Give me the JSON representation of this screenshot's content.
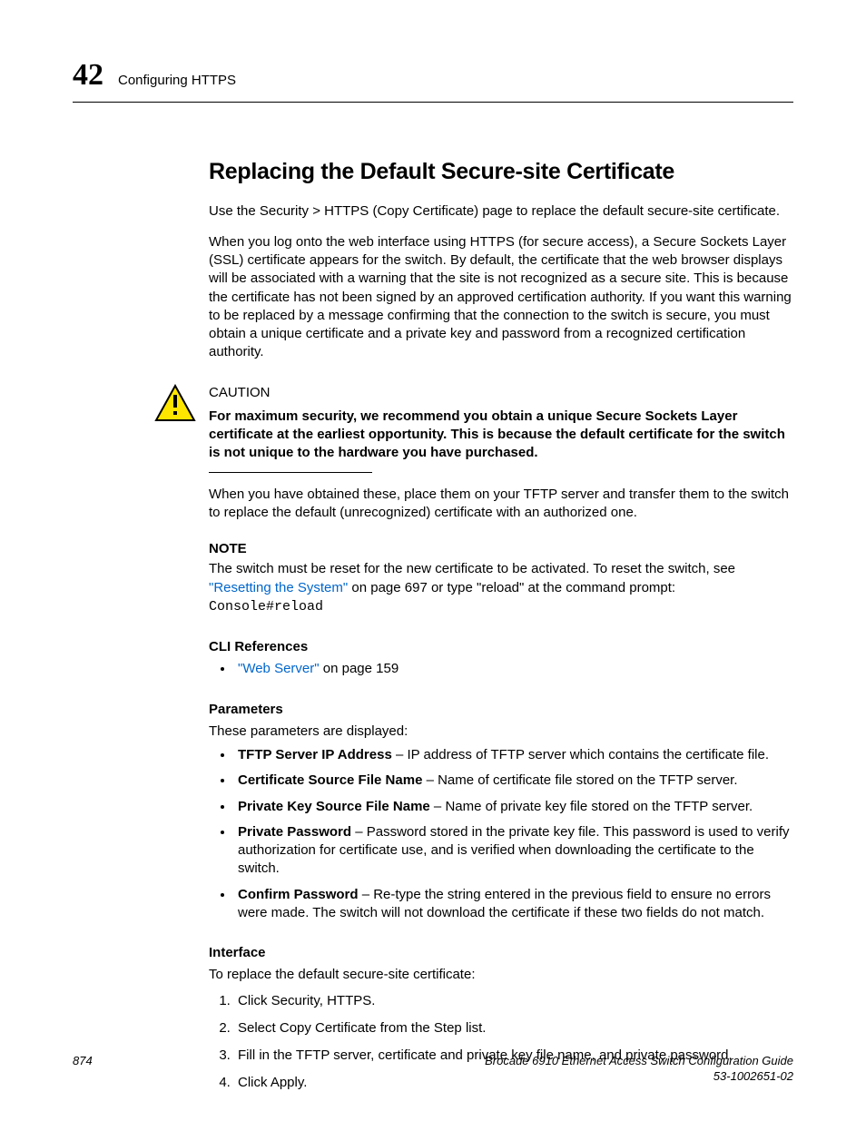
{
  "header": {
    "chapter_number": "42",
    "chapter_title": "Configuring HTTPS"
  },
  "section_title": "Replacing the Default Secure-site Certificate",
  "intro": "Use the Security > HTTPS (Copy Certificate) page to replace the default secure-site certificate.",
  "para1": "When you log onto the web interface using HTTPS (for secure access), a Secure Sockets Layer (SSL) certificate appears for the switch. By default, the certificate that the web browser displays will be associated with a warning that the site is not recognized as a secure site. This is because the certificate has not been signed by an approved certification authority. If you want this warning to be replaced by a message confirming that the connection to the switch is secure, you must obtain a unique certificate and a private key and password from a recognized certification authority.",
  "caution": {
    "label": "CAUTION",
    "text": "For maximum security, we recommend you obtain a unique Secure Sockets Layer certificate at the earliest opportunity. This is because the default certificate for the switch is not unique to the hardware you have purchased."
  },
  "para2": "When you have obtained these, place them on your TFTP server and transfer them to the switch to replace the default (unrecognized) certificate with an authorized one.",
  "note": {
    "label": "NOTE",
    "pre": "The switch must be reset for the new certificate to be activated. To reset the switch, see ",
    "link1": "\"Resetting the System\"",
    "mid": " on page 697 or type \"reload\" at the command prompt: ",
    "cmd": "Console#reload"
  },
  "cli": {
    "heading": "CLI References",
    "link": "\"Web Server\"",
    "tail": " on page 159"
  },
  "parameters": {
    "heading": "Parameters",
    "intro": "These parameters are displayed:",
    "items": [
      {
        "name": "TFTP Server IP Address",
        "desc": " – IP address of TFTP server which contains the certificate file."
      },
      {
        "name": "Certificate Source File Name",
        "desc": " – Name of certificate file stored on the TFTP server."
      },
      {
        "name": "Private Key Source File Name",
        "desc": " – Name of private key file stored on the TFTP server."
      },
      {
        "name": "Private Password",
        "desc": " – Password stored in the private key file. This password is used to verify authorization for certificate use, and is verified when downloading the certificate to the switch."
      },
      {
        "name": "Confirm Password",
        "desc": " – Re-type the string entered in the previous field to ensure no errors were made. The switch will not download the certificate if these two fields do not match."
      }
    ]
  },
  "interface": {
    "heading": "Interface",
    "intro": "To replace the default secure-site certificate:",
    "steps": [
      "Click Security, HTTPS.",
      "Select Copy Certificate from the Step list.",
      "Fill in the TFTP server, certificate and private key file name, and private password.",
      "Click Apply."
    ]
  },
  "footer": {
    "page": "874",
    "title": "Brocade 6910 Ethernet Access Switch Configuration Guide",
    "docnum": "53-1002651-02"
  }
}
